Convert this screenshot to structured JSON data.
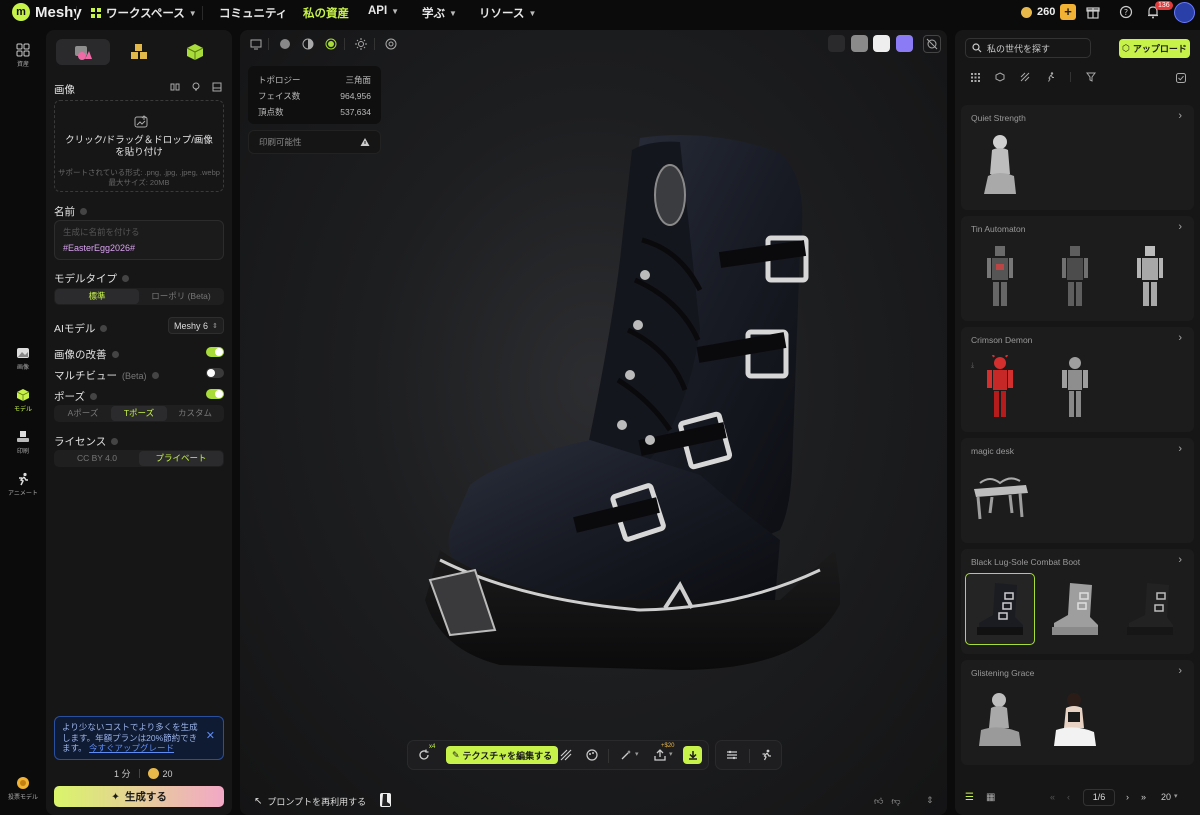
{
  "nav": {
    "logo": "Meshy",
    "workspace": "ワークスペース",
    "community": "コミュニティ",
    "my_assets": "私の資産",
    "api": "API",
    "learn": "学ぶ",
    "resources": "リソース",
    "credits": "260",
    "notifications": "136"
  },
  "rail": {
    "assets": "資産",
    "image": "画像",
    "model": "モデル",
    "print": "印刷",
    "animate": "アニメート",
    "bottom": "投票モデル"
  },
  "panel": {
    "image_label": "画像",
    "dropzone_title": "クリック/ドラッグ＆ドロップ/画像を貼り付け",
    "dropzone_formats": "サポートされている形式: .png, .jpg, .jpeg, .webp",
    "dropzone_maxsize": "最大サイズ: 20MB",
    "name_label": "名前",
    "name_placeholder": "生成に名前を付ける",
    "name_tag": "#EasterEgg2026#",
    "model_type_label": "モデルタイプ",
    "model_type_options": [
      "標準",
      "ローポリ (Beta)"
    ],
    "ai_model_label": "AIモデル",
    "ai_model_value": "Meshy 6",
    "image_enhance_label": "画像の改善",
    "image_enhance_on": true,
    "multiview_label": "マルチビュー",
    "multiview_beta": "(Beta)",
    "multiview_on": false,
    "pose_label": "ポーズ",
    "pose_on": true,
    "pose_options": [
      "Aポーズ",
      "Tポーズ",
      "カスタム"
    ],
    "license_label": "ライセンス",
    "license_options": [
      "CC BY 4.0",
      "プライベート"
    ],
    "promo_text": "より少ないコストでより多くを生成します。年額プランは20%節約できます。",
    "promo_link": "今すぐアップグレード",
    "time": "1 分",
    "cost": "20",
    "generate": "生成する"
  },
  "viewport": {
    "topology_label": "トポロジー",
    "topology_value": "三角面",
    "faces_label": "フェイス数",
    "faces_value": "964,956",
    "vertices_label": "頂点数",
    "vertices_value": "537,634",
    "printability": "印刷可能性",
    "retry_badge": "x4",
    "edit_texture": "テクスチャを編集する",
    "export_badge": "+$20",
    "reuse_prompt": "プロンプトを再利用する",
    "swatch_colors": [
      "#8a8a8a",
      "#eeeeee",
      "#8b7cf6"
    ],
    "accent": "#c7f24a"
  },
  "right": {
    "search_placeholder": "私の世代を探す",
    "upload": "アップロード",
    "groups": [
      {
        "title": "Quiet Strength"
      },
      {
        "title": "Tin Automaton"
      },
      {
        "title": "Crimson Demon"
      },
      {
        "title": "magic desk"
      },
      {
        "title": "Black Lug-Sole Combat Boot"
      },
      {
        "title": "Glistening Grace"
      }
    ],
    "page": "1/6",
    "page_size": "20"
  }
}
